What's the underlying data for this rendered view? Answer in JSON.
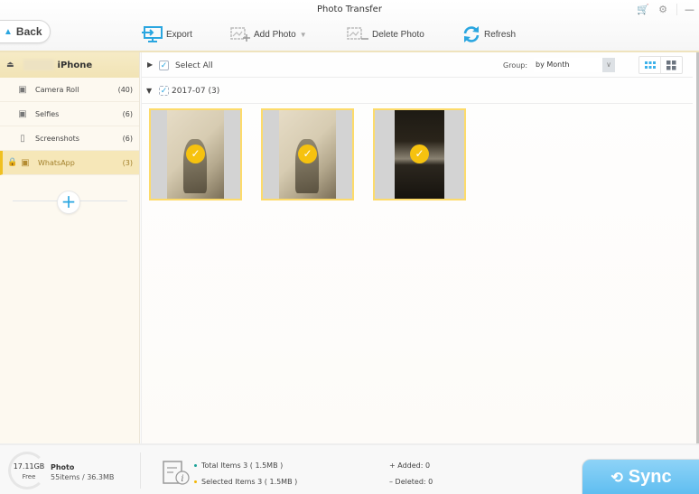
{
  "window": {
    "title": "Photo Transfer",
    "controls": {
      "cart_icon": "cart-icon",
      "settings_icon": "gear-icon",
      "minimize_label": "—"
    }
  },
  "toolbar": {
    "back_label": "Back",
    "export_label": "Export",
    "add_photo_label": "Add Photo",
    "delete_photo_label": "Delete Photo",
    "refresh_label": "Refresh"
  },
  "sidebar": {
    "device_name": "iPhone",
    "albums": [
      {
        "name": "Camera Roll",
        "count": "(40)",
        "icon": "camera-icon",
        "active": false
      },
      {
        "name": "Selfies",
        "count": "(6)",
        "icon": "selfie-camera-icon",
        "active": false
      },
      {
        "name": "Screenshots",
        "count": "(6)",
        "icon": "phone-icon",
        "active": false
      },
      {
        "name": "WhatsApp",
        "count": "(3)",
        "icon": "image-folder-icon",
        "active": true,
        "locked": true
      }
    ],
    "add_album_label": "+"
  },
  "main": {
    "select_all_label": "Select All",
    "select_all_checked": true,
    "group_label": "Group:",
    "group_value": "by Month",
    "view_mode": "small-grid",
    "groups": [
      {
        "label": "2017-07 (3)",
        "checked": true,
        "photos": [
          {
            "type": "painting",
            "selected": true
          },
          {
            "type": "painting",
            "selected": true
          },
          {
            "type": "dark-photo",
            "selected": true
          }
        ]
      }
    ]
  },
  "footer": {
    "storage_free": "17.11GB",
    "storage_free_label": "Free",
    "category": "Photo",
    "category_size": "55items / 36.3MB",
    "total_items": "Total Items 3 ( 1.5MB )",
    "selected_items": "Selected Items 3 ( 1.5MB )",
    "added": "Added: 0",
    "deleted": "Deleted: 0",
    "sync_label": "Sync",
    "colors": {
      "total_dot": "#1aa198",
      "selected_dot": "#f2b705",
      "sync": "#6cc4f3",
      "accent": "#2aa6e0"
    }
  }
}
